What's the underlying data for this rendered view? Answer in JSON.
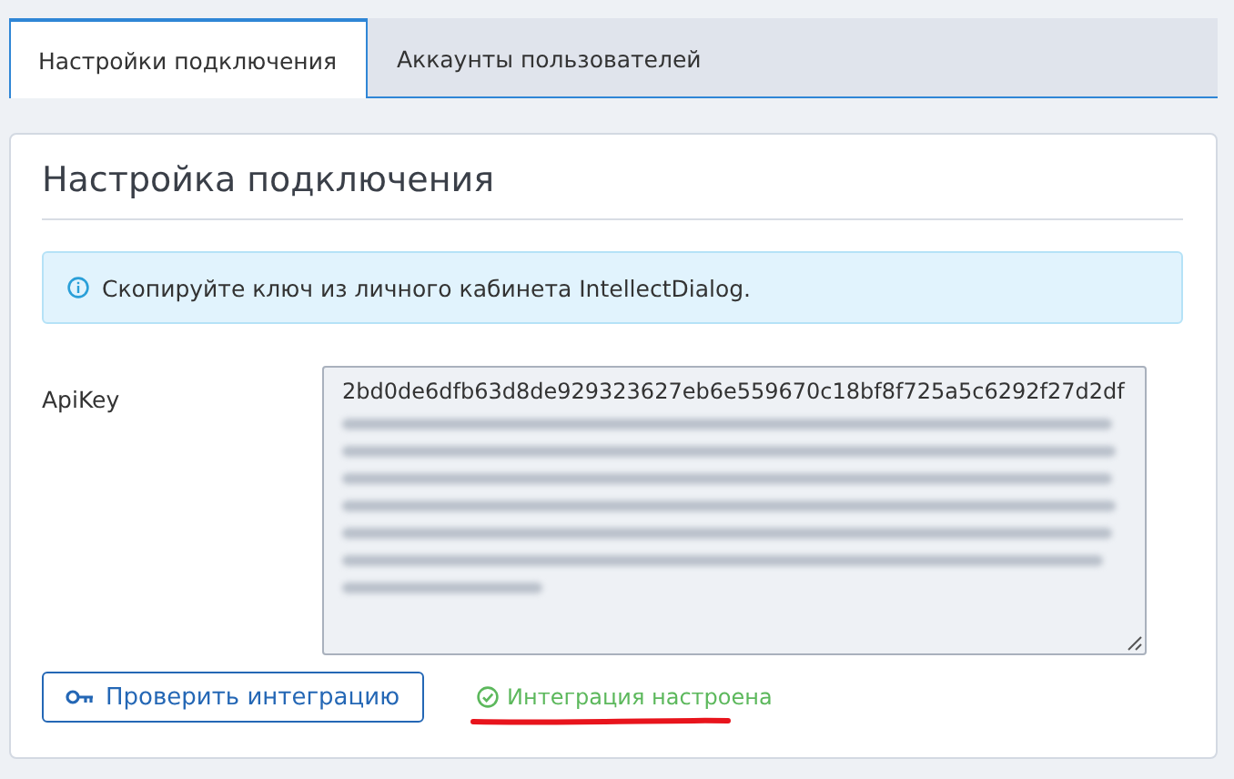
{
  "tabs": [
    {
      "label": "Настройки подключения",
      "selected": true
    },
    {
      "label": "Аккаунты пользователей",
      "selected": false
    }
  ],
  "panel": {
    "title": "Настройка подключения",
    "info": "Скопируйте ключ из личного кабинета IntellectDialog.",
    "api_key": {
      "label": "ApiKey",
      "value": "2bd0de6dfb63d8de929323627eb6e559670c18bf8f725a5c6292f27d2df"
    },
    "check_button": "Проверить интеграцию",
    "status": {
      "kind": "success",
      "text": "Интеграция настроена"
    }
  }
}
